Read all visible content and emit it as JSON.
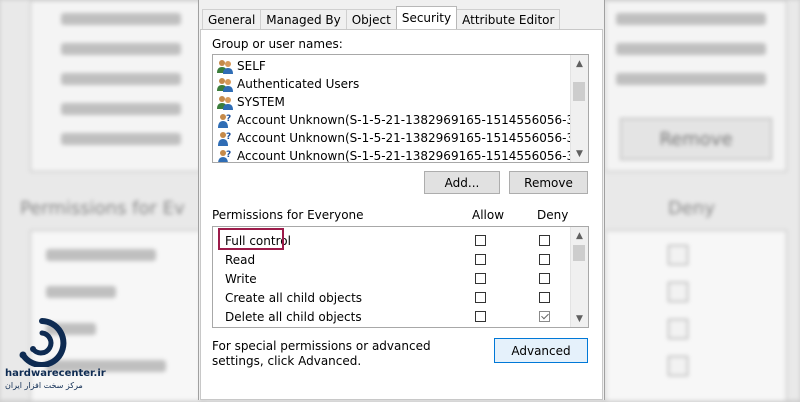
{
  "tabs": [
    {
      "label": "General",
      "active": false
    },
    {
      "label": "Managed By",
      "active": false
    },
    {
      "label": "Object",
      "active": false
    },
    {
      "label": "Security",
      "active": true
    },
    {
      "label": "Attribute Editor",
      "active": false
    }
  ],
  "groups": {
    "label": "Group or user names:",
    "items": [
      {
        "name": "SELF",
        "icon": "users-icon"
      },
      {
        "name": "Authenticated Users",
        "icon": "users-icon"
      },
      {
        "name": "SYSTEM",
        "icon": "users-icon"
      },
      {
        "name": "Account Unknown(S-1-5-21-1382969165-1514556056-3839793...",
        "icon": "unknown-user-icon"
      },
      {
        "name": "Account Unknown(S-1-5-21-1382969165-1514556056-3839793...",
        "icon": "unknown-user-icon"
      },
      {
        "name": "Account Unknown(S-1-5-21-1382969165-1514556056-3839793...",
        "icon": "unknown-user-icon"
      }
    ],
    "add_label": "Add...",
    "remove_label": "Remove"
  },
  "permissions": {
    "label": "Permissions for Everyone",
    "allow_header": "Allow",
    "deny_header": "Deny",
    "rows": [
      {
        "name": "Full control",
        "allow": false,
        "deny": false,
        "highlighted": true
      },
      {
        "name": "Read",
        "allow": false,
        "deny": false
      },
      {
        "name": "Write",
        "allow": false,
        "deny": false
      },
      {
        "name": "Create all child objects",
        "allow": false,
        "deny": false
      },
      {
        "name": "Delete all child objects",
        "allow": false,
        "deny": true
      }
    ]
  },
  "advanced": {
    "note": "For special permissions or advanced settings, click Advanced.",
    "button_label": "Advanced"
  },
  "logo": {
    "name": "hardwarecenter.ir",
    "subtitle": "مرکز سخت افزار ایران"
  },
  "background": {
    "remove_label": "Remove",
    "permissions_label": "Permissions for Ev",
    "deny_label": "Deny"
  },
  "colors": {
    "highlight": "#9c1b4a",
    "advanced_border": "#0078d7",
    "logo": "#0e2b52"
  }
}
